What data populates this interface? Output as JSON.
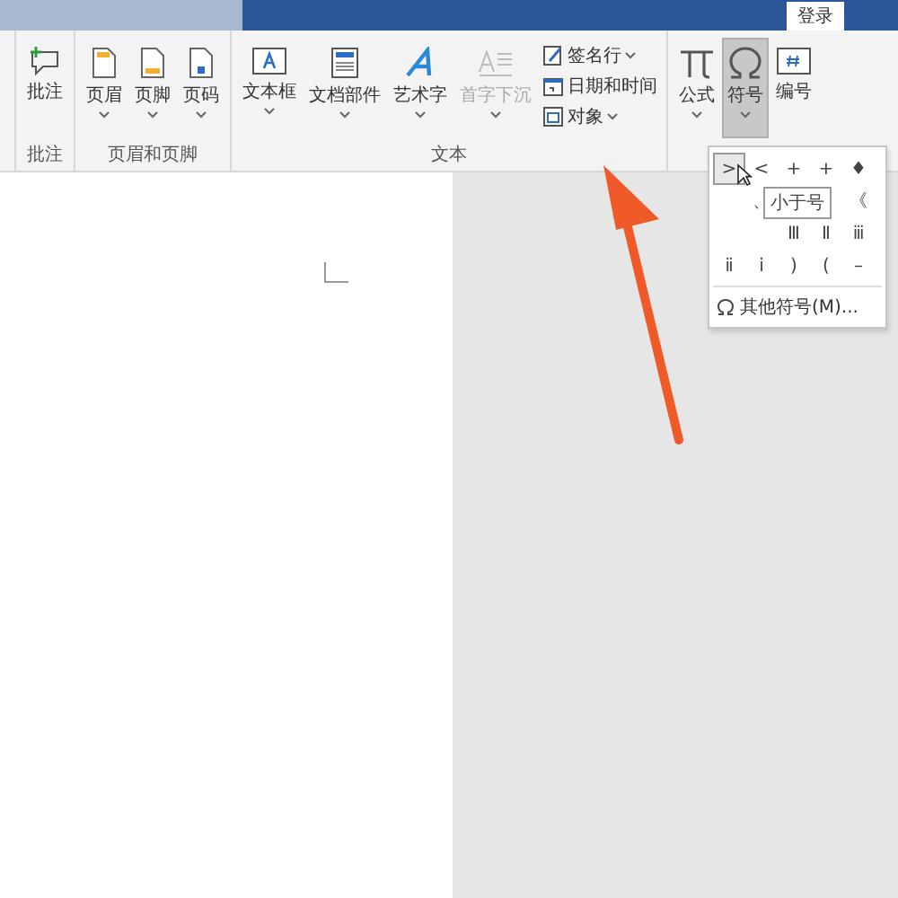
{
  "title_bar": {
    "login_button": "登录"
  },
  "ribbon": {
    "groups": [
      {
        "label": "批注",
        "buttons": [
          {
            "label": "批注",
            "kind": "comment",
            "has_menu": false,
            "selected": false,
            "disabled": false
          }
        ]
      },
      {
        "label": "页眉和页脚",
        "buttons": [
          {
            "label": "页眉",
            "kind": "header",
            "has_menu": true,
            "selected": false,
            "disabled": false
          },
          {
            "label": "页脚",
            "kind": "footer",
            "has_menu": true,
            "selected": false,
            "disabled": false
          },
          {
            "label": "页码",
            "kind": "page-number",
            "has_menu": true,
            "selected": false,
            "disabled": false
          }
        ]
      },
      {
        "label": "文本",
        "buttons": [
          {
            "label": "文本框",
            "kind": "textbox",
            "has_menu": true,
            "selected": false,
            "disabled": false
          },
          {
            "label": "文档部件",
            "kind": "parts",
            "has_menu": true,
            "selected": false,
            "disabled": false
          },
          {
            "label": "艺术字",
            "kind": "wordart",
            "has_menu": true,
            "selected": false,
            "disabled": false
          },
          {
            "label": "首字下沉",
            "kind": "dropcap",
            "has_menu": true,
            "selected": false,
            "disabled": true
          }
        ],
        "small_buttons": [
          {
            "label": "签名行",
            "kind": "signature",
            "has_menu": true
          },
          {
            "label": "日期和时间",
            "kind": "calendar",
            "has_menu": false
          },
          {
            "label": "对象",
            "kind": "object",
            "has_menu": true
          }
        ]
      },
      {
        "buttons": [
          {
            "label": "公式",
            "kind": "equation",
            "has_menu": true,
            "selected": false,
            "disabled": false
          },
          {
            "label": "符号",
            "kind": "omega",
            "has_menu": true,
            "selected": true,
            "disabled": false
          },
          {
            "label": "编号",
            "kind": "number",
            "has_menu": false,
            "selected": false,
            "disabled": false
          }
        ]
      }
    ]
  },
  "symbol_menu": {
    "rows": [
      [
        {
          "kind": "symbol",
          "symbol": ">",
          "selected": true
        },
        {
          "kind": "symbol",
          "symbol": "<",
          "selected": false
        },
        {
          "kind": "symbol",
          "symbol": "+",
          "selected": false
        },
        {
          "kind": "symbol",
          "symbol": "+",
          "selected": false
        },
        {
          "kind": "symbol",
          "symbol": "♦",
          "selected": false
        }
      ],
      [
        {
          "kind": "blank"
        },
        {
          "kind": "symbol",
          "symbol": "、",
          "selected": false
        },
        {
          "kind": "blank"
        },
        {
          "kind": "blank"
        },
        {
          "kind": "symbol",
          "symbol": "《",
          "selected": false
        }
      ],
      [
        {
          "kind": "blank"
        },
        {
          "kind": "blank"
        },
        {
          "kind": "symbol",
          "symbol": "Ⅲ",
          "selected": false
        },
        {
          "kind": "symbol",
          "symbol": "Ⅱ",
          "selected": false
        },
        {
          "kind": "symbol",
          "symbol": "ⅲ",
          "selected": false
        }
      ],
      [
        {
          "kind": "symbol",
          "symbol": "ⅱ",
          "selected": false
        },
        {
          "kind": "symbol",
          "symbol": "ⅰ",
          "selected": false
        },
        {
          "kind": "symbol",
          "symbol": ")",
          "selected": false
        },
        {
          "kind": "symbol",
          "symbol": "(",
          "selected": false
        },
        {
          "kind": "symbol",
          "symbol": "–",
          "selected": false
        }
      ]
    ],
    "tooltip": "小于号",
    "more_button": "其他符号(M)..."
  }
}
